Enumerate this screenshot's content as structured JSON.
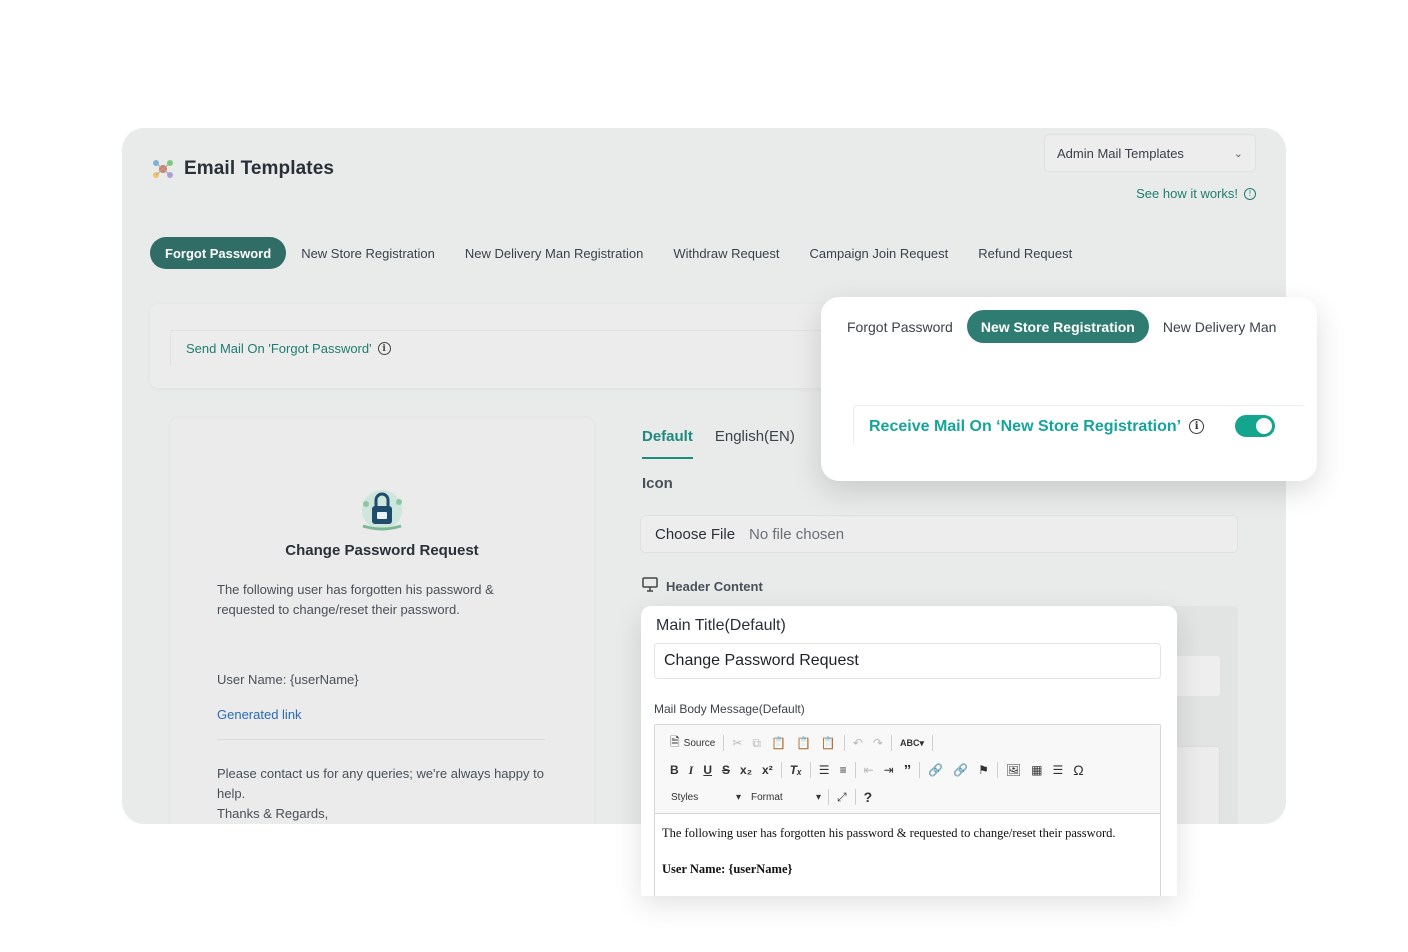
{
  "header": {
    "title": "Email Templates",
    "template_select": "Admin Mail Templates",
    "how_it_works": "See how it works!"
  },
  "tabs": [
    {
      "label": "Forgot Password",
      "active": true
    },
    {
      "label": "New Store Registration",
      "active": false
    },
    {
      "label": "New Delivery Man Registration",
      "active": false
    },
    {
      "label": "Withdraw Request",
      "active": false
    },
    {
      "label": "Campaign Join Request",
      "active": false
    },
    {
      "label": "Refund Request",
      "active": false
    }
  ],
  "send_mail_label": "Send Mail On 'Forgot Password'",
  "preview": {
    "title": "Change Password Request",
    "body": "The following user has forgotten his password & requested to change/reset their password.",
    "user_name": "User Name: {userName}",
    "link": "Generated link",
    "contact": "Please contact us for any queries; we're always happy to help.",
    "regards": "Thanks & Regards,"
  },
  "lang_tabs": [
    {
      "label": "Default",
      "active": true
    },
    {
      "label": "English(EN)",
      "active": false
    }
  ],
  "icon_label": "Icon",
  "file_input": {
    "button": "Choose File",
    "status": "No file chosen"
  },
  "header_content_label": "Header Content",
  "popup_tabs": {
    "tabs": [
      {
        "label": "Forgot Password",
        "active": false
      },
      {
        "label": "New Store Registration",
        "active": true
      },
      {
        "label": "New Delivery Man",
        "active": false
      }
    ],
    "receive_mail_label": "Receive Mail On ‘New Store Registration’",
    "toggle_on": true
  },
  "editor": {
    "main_title_label": "Main Title(Default)",
    "main_title_value": "Change Password Request",
    "body_label": "Mail Body Message(Default)",
    "toolbar": {
      "source": "Source",
      "styles": "Styles",
      "format": "Format"
    },
    "content_line1": "The following user has forgotten his password & requested to change/reset their password.",
    "content_line2": "User Name: {userName}"
  },
  "colors": {
    "accent": "#2f7d72",
    "accent_text": "#16a59a",
    "toggle": "#13a58e",
    "link": "#2a6bb6"
  }
}
